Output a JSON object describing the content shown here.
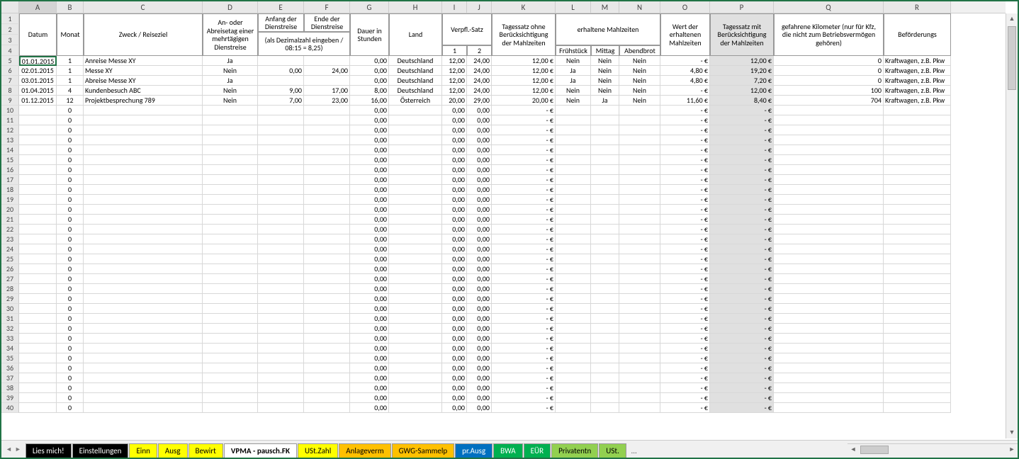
{
  "columns": [
    {
      "letter": "A",
      "width": 53
    },
    {
      "letter": "B",
      "width": 38
    },
    {
      "letter": "C",
      "width": 168
    },
    {
      "letter": "D",
      "width": 78
    },
    {
      "letter": "E",
      "width": 65
    },
    {
      "letter": "F",
      "width": 65
    },
    {
      "letter": "G",
      "width": 55
    },
    {
      "letter": "H",
      "width": 75
    },
    {
      "letter": "I",
      "width": 35
    },
    {
      "letter": "J",
      "width": 35
    },
    {
      "letter": "K",
      "width": 90
    },
    {
      "letter": "L",
      "width": 50
    },
    {
      "letter": "M",
      "width": 40
    },
    {
      "letter": "N",
      "width": 58
    },
    {
      "letter": "O",
      "width": 70
    },
    {
      "letter": "P",
      "width": 90
    },
    {
      "letter": "Q",
      "width": 155
    },
    {
      "letter": "R",
      "width": 95
    }
  ],
  "headers": {
    "A": "Datum",
    "B": "Monat",
    "C": "Zweck / Reiseziel",
    "D": "An- oder Abreisetag einer mehrtägigen Dienstreise",
    "E": "Anfang der Dienstreise",
    "F": "Ende der Dienstreise",
    "EF_sub": "(als Dezimalzahl eingeben / 08:15 = 8,25)",
    "G": "Dauer in Stunden",
    "H": "Land",
    "IJ": "Verpfl.-Satz",
    "I": "1",
    "J": "2",
    "K": "Tagessatz ohne Berücksichtigung der Mahlzeiten",
    "LMN": "erhaltene Mahlzeiten",
    "L": "Frühstück",
    "M": "Mittag",
    "N": "Abendbrot",
    "O": "Wert der erhaltenen Mahlzeiten",
    "P": "Tagessatz mit Berücksichtigung der Mahlzeiten",
    "Q": "gefahrene Kilometer (nur für Kfz, die nicht zum Betriebsvermögen gehören)",
    "R": "Beförderungs"
  },
  "rows": [
    {
      "n": 5,
      "A": "01.01.2015",
      "B": "1",
      "C": "Anreise Messe XY",
      "D": "Ja",
      "E": "",
      "F": "",
      "G": "0,00",
      "H": "Deutschland",
      "I": "12,00",
      "J": "24,00",
      "K": "12,00 €",
      "L": "Nein",
      "M": "Nein",
      "N": "Nein",
      "O": "-   €",
      "P": "12,00 €",
      "Q": "0",
      "R": "Kraftwagen, z.B. Pkw"
    },
    {
      "n": 6,
      "A": "02.01.2015",
      "B": "1",
      "C": "Messe XY",
      "D": "Nein",
      "E": "0,00",
      "F": "24,00",
      "G": "0,00",
      "H": "Deutschland",
      "I": "12,00",
      "J": "24,00",
      "K": "12,00 €",
      "L": "Ja",
      "M": "Nein",
      "N": "Nein",
      "O": "4,80 €",
      "P": "19,20 €",
      "Q": "0",
      "R": "Kraftwagen, z.B. Pkw"
    },
    {
      "n": 7,
      "A": "03.01.2015",
      "B": "1",
      "C": "Abreise Messe XY",
      "D": "Ja",
      "E": "",
      "F": "",
      "G": "0,00",
      "H": "Deutschland",
      "I": "12,00",
      "J": "24,00",
      "K": "12,00 €",
      "L": "Ja",
      "M": "Nein",
      "N": "Nein",
      "O": "4,80 €",
      "P": "7,20 €",
      "Q": "0",
      "R": "Kraftwagen, z.B. Pkw"
    },
    {
      "n": 8,
      "A": "01.04.2015",
      "B": "4",
      "C": "Kundenbesuch ABC",
      "D": "Nein",
      "E": "9,00",
      "F": "17,00",
      "G": "8,00",
      "H": "Deutschland",
      "I": "12,00",
      "J": "24,00",
      "K": "12,00 €",
      "L": "Nein",
      "M": "Nein",
      "N": "Nein",
      "O": "-   €",
      "P": "12,00 €",
      "Q": "100",
      "R": "Kraftwagen, z.B. Pkw"
    },
    {
      "n": 9,
      "A": "01.12.2015",
      "B": "12",
      "C": "Projektbesprechung 789",
      "D": "Nein",
      "E": "7,00",
      "F": "23,00",
      "G": "16,00",
      "H": "Österreich",
      "I": "20,00",
      "J": "29,00",
      "K": "20,00 €",
      "L": "Nein",
      "M": "Ja",
      "N": "Nein",
      "O": "11,60 €",
      "P": "8,40 €",
      "Q": "704",
      "R": "Kraftwagen, z.B. Pkw"
    }
  ],
  "empty_template": {
    "B": "0",
    "G": "0,00",
    "I": "0,00",
    "J": "0,00",
    "K": "-   €",
    "O": "-   €",
    "P": "-   €"
  },
  "empty_start": 10,
  "empty_end": 40,
  "tabs": [
    {
      "label": "Lies mich!",
      "cls": "black"
    },
    {
      "label": "Einstellungen",
      "cls": "black"
    },
    {
      "label": "Einn",
      "cls": "yellow"
    },
    {
      "label": "Ausg",
      "cls": "yellow"
    },
    {
      "label": "Bewirt",
      "cls": "yellow"
    },
    {
      "label": "VPMA - pausch.FK",
      "cls": "active"
    },
    {
      "label": "USt.Zahl",
      "cls": "yellow"
    },
    {
      "label": "Anlageverm",
      "cls": "orange"
    },
    {
      "label": "GWG-Sammelp",
      "cls": "orange"
    },
    {
      "label": "pr.Ausg",
      "cls": "blue"
    },
    {
      "label": "BWA",
      "cls": "green"
    },
    {
      "label": "EÜR",
      "cls": "green"
    },
    {
      "label": "Privatentn",
      "cls": "lgreen"
    },
    {
      "label": "USt.",
      "cls": "lgreen"
    }
  ],
  "tab_more": "…",
  "selected_cell": "A5"
}
